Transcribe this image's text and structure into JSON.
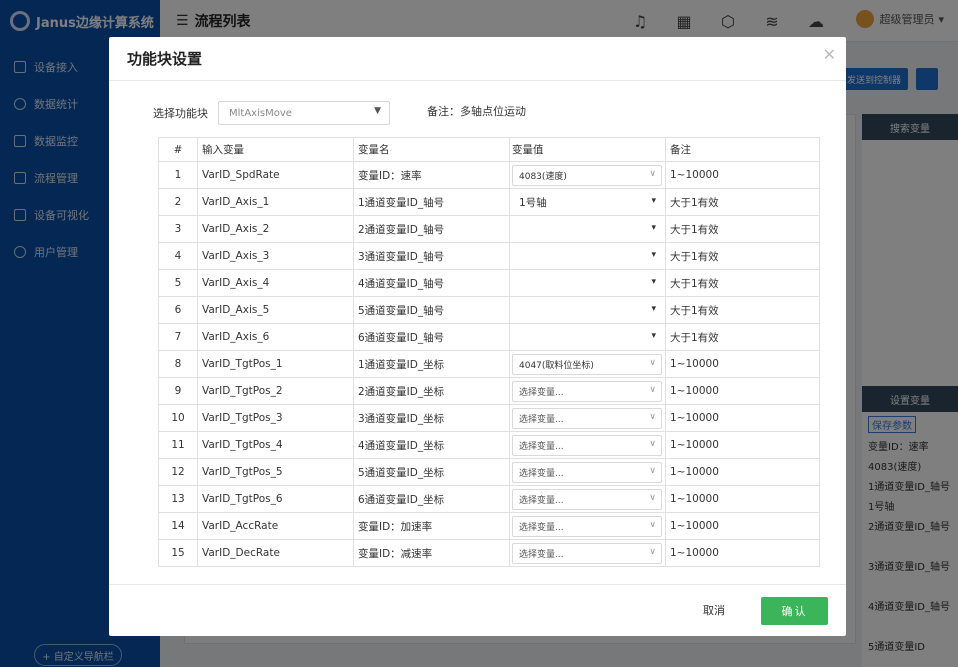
{
  "app": {
    "brand": "Janus边缘计算系统"
  },
  "sidebar": {
    "items": [
      {
        "label": "设备接入",
        "icon": "device-icon"
      },
      {
        "label": "数据统计",
        "icon": "clock-icon"
      },
      {
        "label": "数据监控",
        "icon": "monitor-icon"
      },
      {
        "label": "流程管理",
        "icon": "flow-icon"
      },
      {
        "label": "设备可视化",
        "icon": "shield-icon"
      },
      {
        "label": "用户管理",
        "icon": "user-icon"
      }
    ],
    "custom_nav": "+ 自定义导航栏"
  },
  "topbar": {
    "page_title": "流程列表",
    "user": "超级管理员",
    "icons": [
      "bell-icon",
      "apps-icon",
      "api-icon",
      "node-icon",
      "cloud-icon"
    ]
  },
  "background": {
    "send_button": "发送到控制器",
    "panel_header": "搜索变量",
    "panel_header2": "设置变量",
    "save_params": "保存参数",
    "lines": [
      "变量ID：速率",
      "4083(速度)",
      "1通道变量ID_轴号",
      "1号轴",
      "2通道变量ID_轴号",
      "3通道变量ID_轴号",
      "4通道变量ID_轴号",
      "5通道变量ID"
    ]
  },
  "modal": {
    "title": "功能块设置",
    "select_label": "选择功能块",
    "select_value": "MltAxisMove",
    "remark": "备注：多轴点位运动",
    "columns": [
      "#",
      "输入变量",
      "变量名",
      "变量值",
      "备注"
    ],
    "rows": [
      {
        "idx": "1",
        "input": "VarID_SpdRate",
        "name": "变量ID：速率",
        "value": "4083(速度)",
        "style": "boxed",
        "note": "1~10000"
      },
      {
        "idx": "2",
        "input": "VarID_Axis_1",
        "name": "1通道变量ID_轴号",
        "value": "1号轴",
        "style": "plain",
        "note": "大于1有效"
      },
      {
        "idx": "3",
        "input": "VarID_Axis_2",
        "name": "2通道变量ID_轴号",
        "value": "",
        "style": "empty",
        "note": "大于1有效"
      },
      {
        "idx": "4",
        "input": "VarID_Axis_3",
        "name": "3通道变量ID_轴号",
        "value": "",
        "style": "empty",
        "note": "大于1有效"
      },
      {
        "idx": "5",
        "input": "VarID_Axis_4",
        "name": "4通道变量ID_轴号",
        "value": "",
        "style": "empty",
        "note": "大于1有效"
      },
      {
        "idx": "6",
        "input": "VarID_Axis_5",
        "name": "5通道变量ID_轴号",
        "value": "",
        "style": "empty",
        "note": "大于1有效"
      },
      {
        "idx": "7",
        "input": "VarID_Axis_6",
        "name": "6通道变量ID_轴号",
        "value": "",
        "style": "empty",
        "note": "大于1有效"
      },
      {
        "idx": "8",
        "input": "VarID_TgtPos_1",
        "name": "1通道变量ID_坐标",
        "value": "4047(取料位坐标)",
        "style": "boxed",
        "note": "1~10000"
      },
      {
        "idx": "9",
        "input": "VarID_TgtPos_2",
        "name": "2通道变量ID_坐标",
        "value": "选择变量...",
        "style": "placeholder",
        "note": "1~10000"
      },
      {
        "idx": "10",
        "input": "VarID_TgtPos_3",
        "name": "3通道变量ID_坐标",
        "value": "选择变量...",
        "style": "placeholder",
        "note": "1~10000"
      },
      {
        "idx": "11",
        "input": "VarID_TgtPos_4",
        "name": "4通道变量ID_坐标",
        "value": "选择变量...",
        "style": "placeholder",
        "note": "1~10000"
      },
      {
        "idx": "12",
        "input": "VarID_TgtPos_5",
        "name": "5通道变量ID_坐标",
        "value": "选择变量...",
        "style": "placeholder",
        "note": "1~10000"
      },
      {
        "idx": "13",
        "input": "VarID_TgtPos_6",
        "name": "6通道变量ID_坐标",
        "value": "选择变量...",
        "style": "placeholder",
        "note": "1~10000"
      },
      {
        "idx": "14",
        "input": "VarID_AccRate",
        "name": "变量ID：加速率",
        "value": "选择变量...",
        "style": "placeholder",
        "note": "1~10000"
      },
      {
        "idx": "15",
        "input": "VarID_DecRate",
        "name": "变量ID：减速率",
        "value": "选择变量...",
        "style": "placeholder",
        "note": "1~10000"
      }
    ],
    "cancel": "取消",
    "confirm": "确认"
  },
  "colors": {
    "sidebar": "#0b4fa6",
    "confirm": "#3cb55a",
    "overlay": "rgba(0,0,0,0.5)"
  }
}
